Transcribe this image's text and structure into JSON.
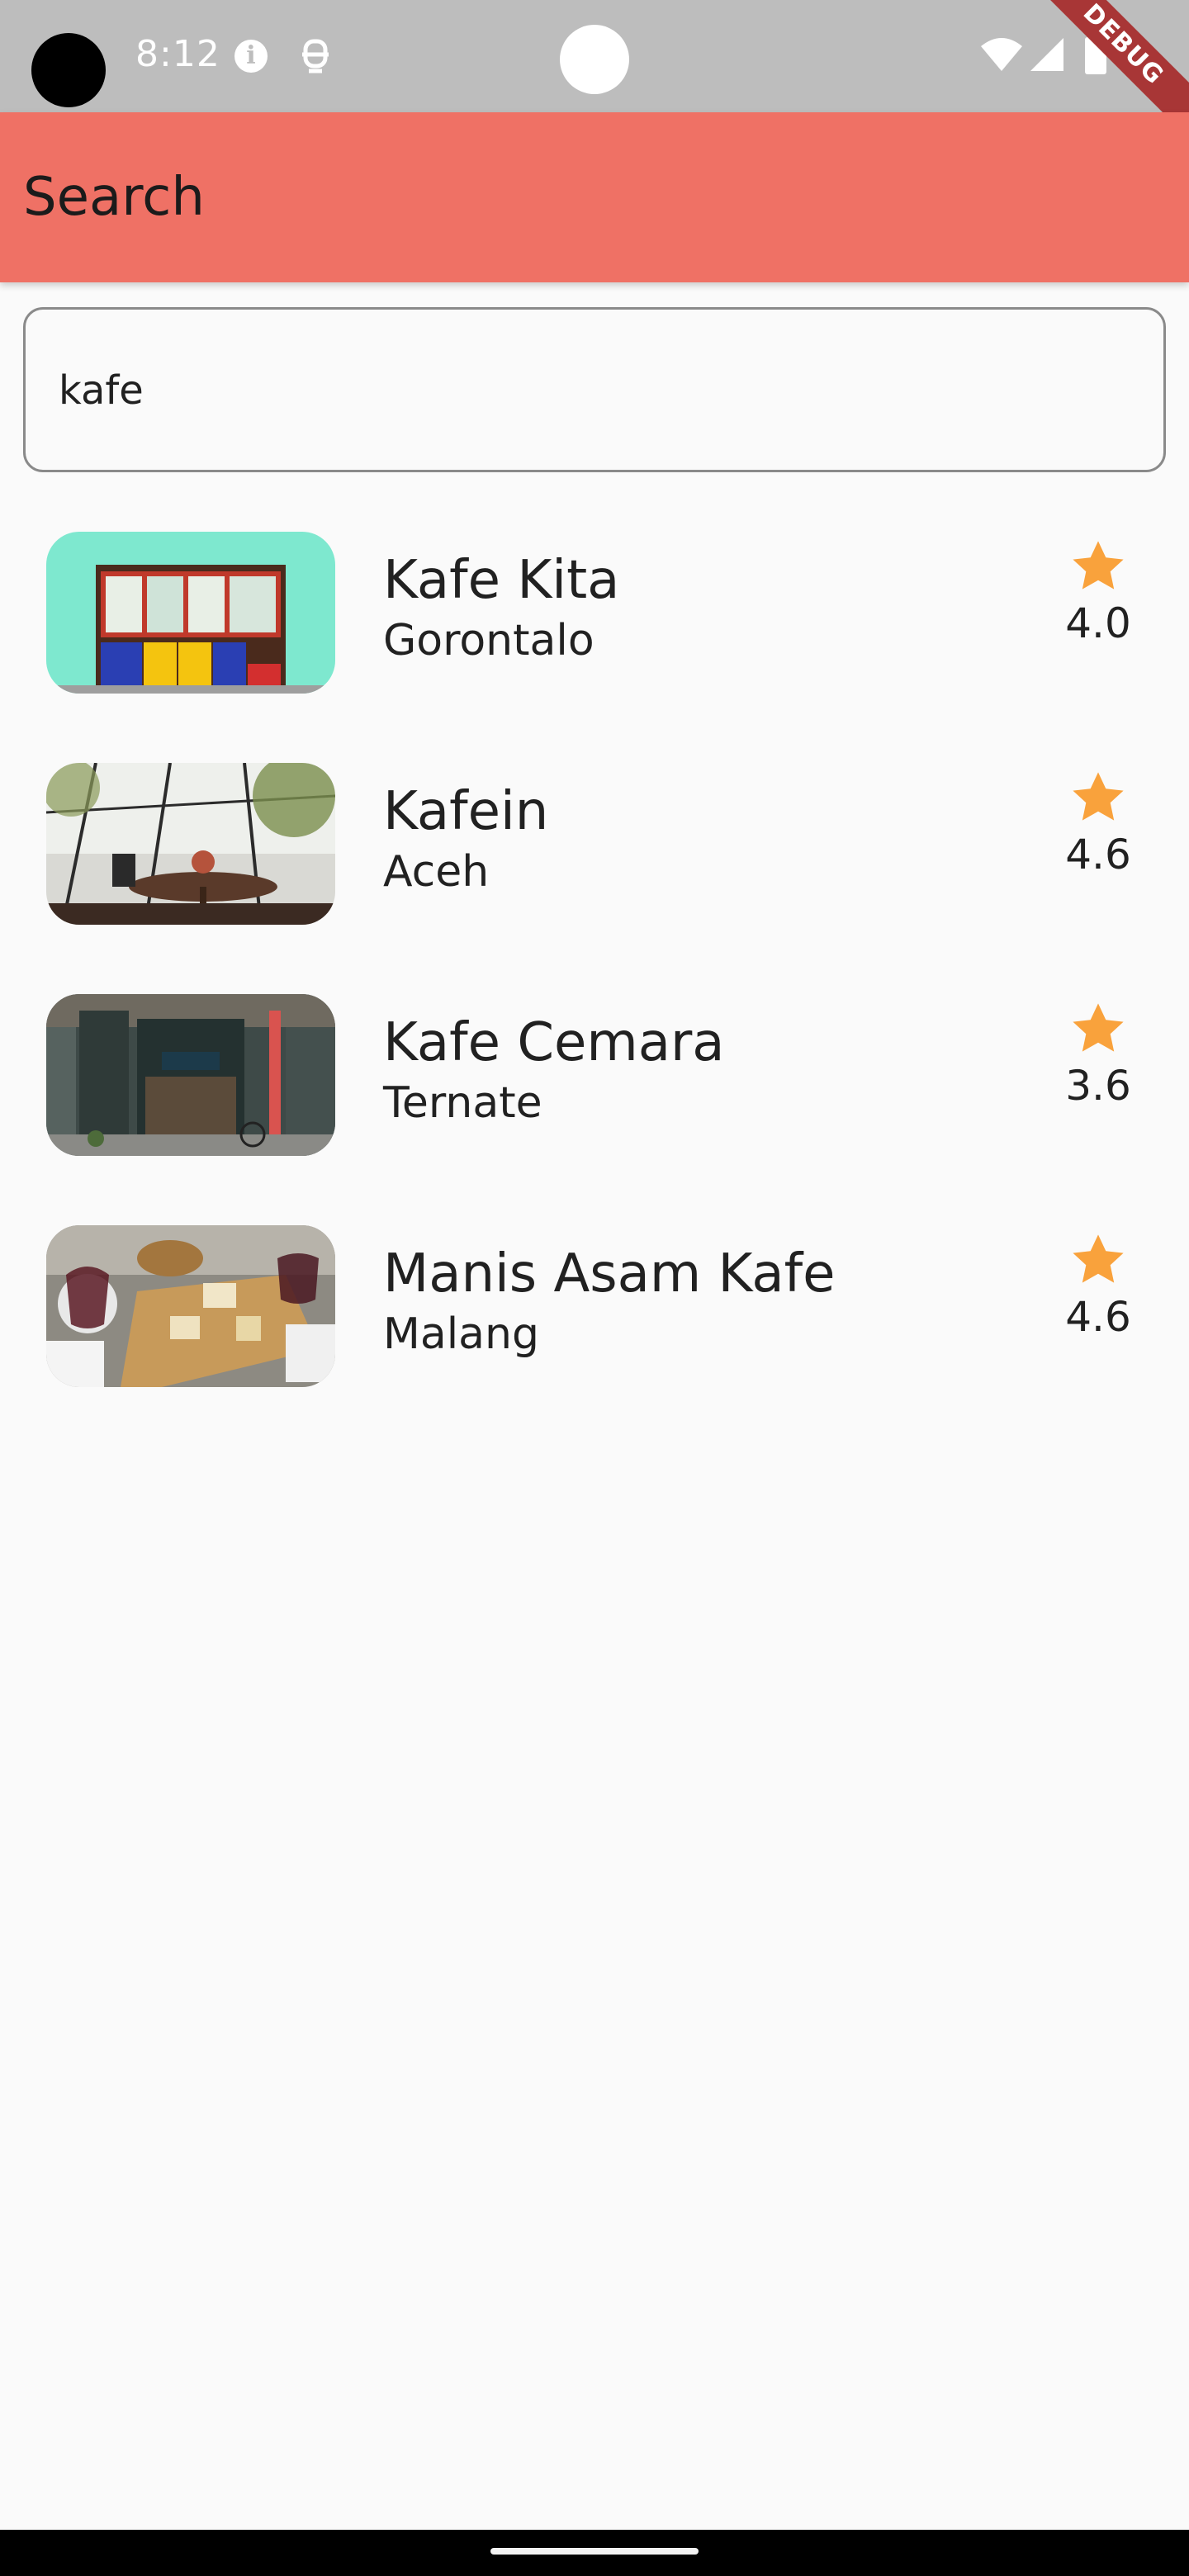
{
  "status_bar": {
    "time": "8:12",
    "debug_label": "DEBUG",
    "icons": [
      "info-icon",
      "notification-icon",
      "wifi-icon",
      "signal-icon",
      "battery-icon"
    ]
  },
  "app_bar": {
    "title": "Search",
    "background": "#ef7165"
  },
  "search": {
    "value": "kafe",
    "placeholder": ""
  },
  "results": [
    {
      "name": "Kafe Kita",
      "city": "Gorontalo",
      "rating": "4.0",
      "image": "storefront-photo"
    },
    {
      "name": "Kafein",
      "city": "Aceh",
      "rating": "4.6",
      "image": "cafe-interior-photo"
    },
    {
      "name": "Kafe Cemara",
      "city": "Ternate",
      "rating": "3.6",
      "image": "cafe-street-photo"
    },
    {
      "name": "Manis Asam Kafe",
      "city": "Malang",
      "rating": "4.6",
      "image": "food-table-photo"
    }
  ],
  "colors": {
    "star": "#f9a23c",
    "status_bar": "#bdbdbd"
  }
}
